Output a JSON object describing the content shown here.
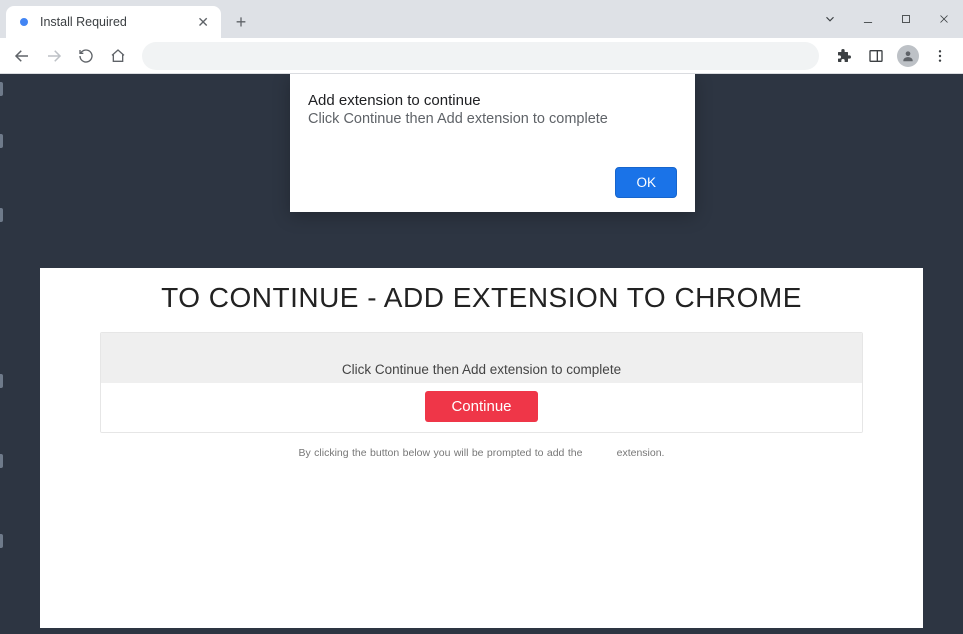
{
  "window": {
    "tab_title": "Install Required"
  },
  "alert": {
    "title": "Add extension to continue",
    "body": "Click Continue then Add extension to complete",
    "ok_label": "OK"
  },
  "page": {
    "heading": "TO CONTINUE - ADD EXTENSION TO CHROME",
    "banner_text": "Click Continue then Add extension to complete",
    "continue_label": "Continue",
    "disclaimer_prefix": "By clicking the button below you will be prompted to add the",
    "disclaimer_suffix": "extension."
  }
}
